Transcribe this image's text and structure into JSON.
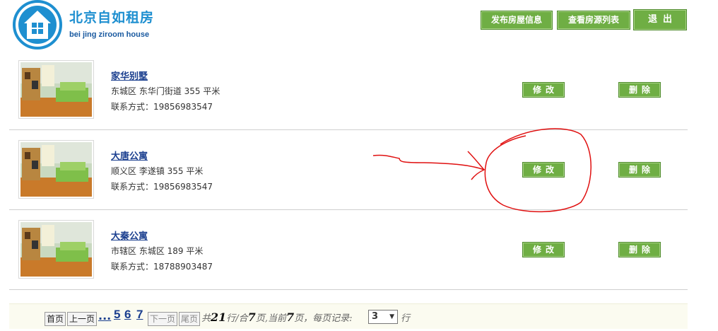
{
  "brand": {
    "name_cn": "北京自如租房",
    "name_en": "bei jing ziroom house"
  },
  "header": {
    "publish_label": "发布房屋信息",
    "view_list_label": "查看房源列表",
    "exit_label": "退出"
  },
  "listings": [
    {
      "title": "家华别墅",
      "address": "东城区 东华门街道 355 平米",
      "contact": "联系方式：19856983547",
      "edit_label": "修改",
      "delete_label": "删除"
    },
    {
      "title": "大唐公寓",
      "address": "顺义区 李遂镇 355 平米",
      "contact": "联系方式：19856983547",
      "edit_label": "修改",
      "delete_label": "删除"
    },
    {
      "title": "大秦公寓",
      "address": "市辖区 东城区 189 平米",
      "contact": "联系方式：18788903487",
      "edit_label": "修改",
      "delete_label": "删除"
    }
  ],
  "pagination": {
    "first_label": "首页",
    "prev_label": "上一页",
    "ellipsis": "...",
    "pages": [
      "5",
      "6",
      "7"
    ],
    "next_label": "下一页",
    "last_label": "尾页",
    "info_prefix": "共",
    "total_rows": "21",
    "info_rows_suffix": "行/合",
    "total_pages": "7",
    "info_pages_suffix": "页,当前",
    "current_page": "7",
    "info_per_page": "页，每页记录:",
    "per_page_value": "3",
    "row_unit": "行"
  },
  "colors": {
    "button_green": "#6fae44",
    "link_blue": "#1b3f8f",
    "brand_blue": "#1e8fd0",
    "annotation_red": "#e01010"
  }
}
